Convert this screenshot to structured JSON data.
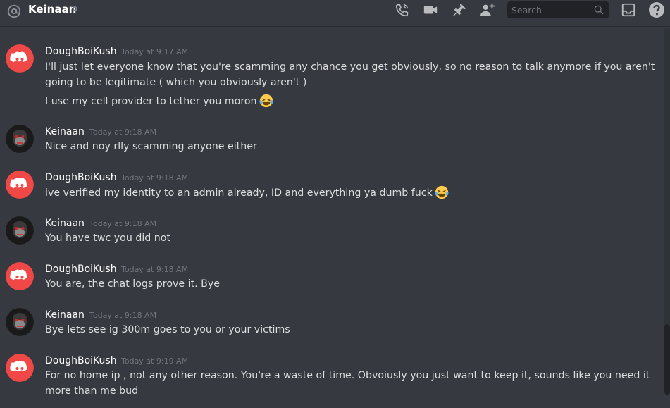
{
  "header": {
    "channel_name": "Keinaan",
    "search_placeholder": "Search",
    "icons": [
      "at-icon",
      "status-dot",
      "call-icon",
      "video-icon",
      "pin-icon",
      "add-friend-icon",
      "search-icon",
      "inbox-icon",
      "help-icon"
    ]
  },
  "colors": {
    "background": "#36393f",
    "discord_red": "#f04747",
    "text": "#dcddde",
    "timestamp": "#72767d"
  },
  "messages": [
    {
      "author": "DoughBoiKush",
      "avatar": "discord-logo-avatar",
      "time": "Today at 9:17 AM",
      "lines": [
        "I'll just let everyone know that you're scamming any chance you get obviously, so no reason to talk anymore if you aren't",
        "going to be legitimate ( which you obviously aren't )",
        "I use my cell provider to tether you moron"
      ]
    },
    {
      "author": "Keinaan",
      "avatar": "monkey-avatar",
      "time": "Today at 9:18 AM",
      "lines": [
        "Nice and noy rlly scamming anyone either"
      ]
    },
    {
      "author": "DoughBoiKush",
      "avatar": "discord-logo-avatar",
      "time": "Today at 9:18 AM",
      "lines": [
        "ive verified my identity to an admin already, ID and everything ya dumb fuck"
      ]
    },
    {
      "author": "Keinaan",
      "avatar": "monkey-avatar",
      "time": "Today at 9:18 AM",
      "lines": [
        "You have twc you did not"
      ]
    },
    {
      "author": "DoughBoiKush",
      "avatar": "discord-logo-avatar",
      "time": "Today at 9:18 AM",
      "lines": [
        "You are, the chat logs prove it. Bye"
      ]
    },
    {
      "author": "Keinaan",
      "avatar": "monkey-avatar",
      "time": "Today at 9:18 AM",
      "lines": [
        "Bye lets see ig 300m goes to you or your victims"
      ]
    },
    {
      "author": "DoughBoiKush",
      "avatar": "discord-logo-avatar",
      "time": "Today at 9:19 AM",
      "lines": [
        "For no home ip , not any other reason. You're a waste of time. Obvoiusly you just want to keep it, sounds like you need it",
        "more than me bud"
      ]
    }
  ]
}
